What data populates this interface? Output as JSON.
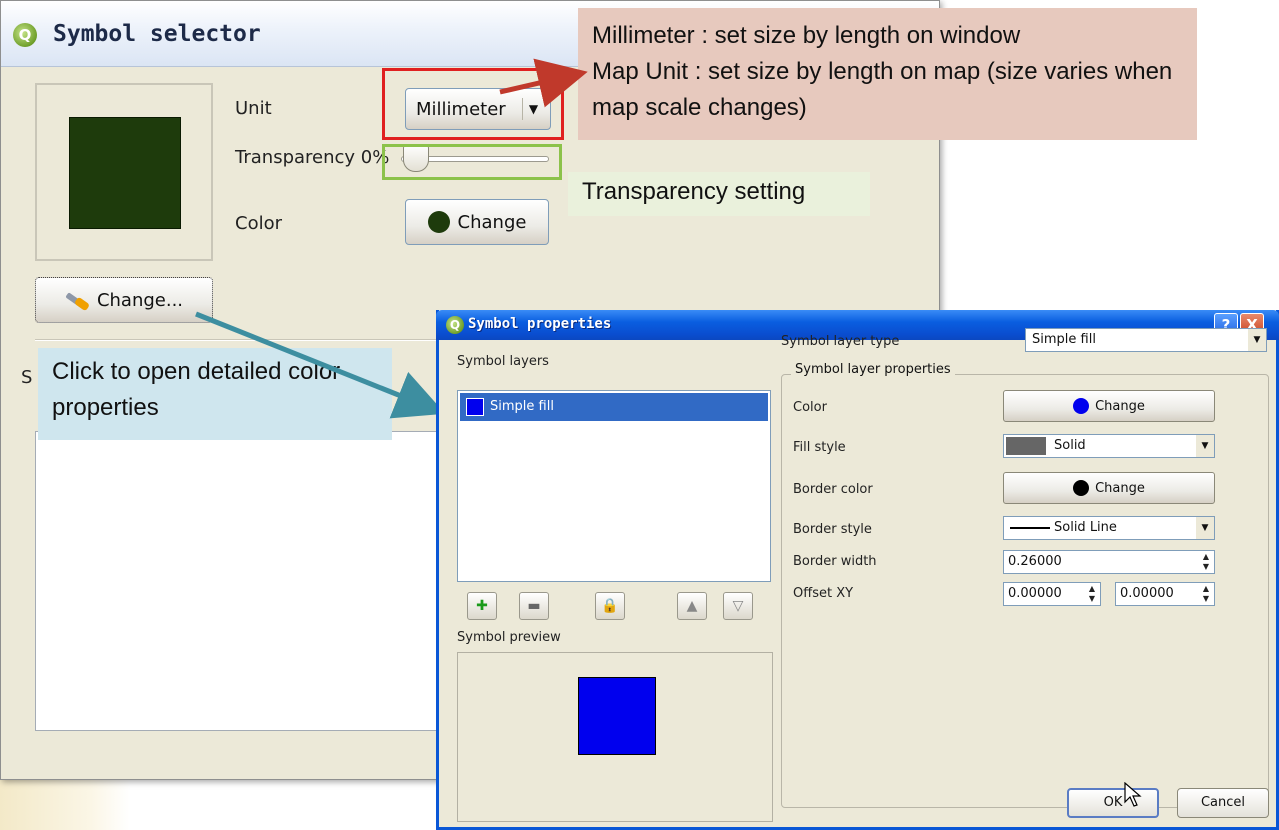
{
  "selector": {
    "title": "Symbol selector",
    "unit_label": "Unit",
    "unit_value": "Millimeter",
    "transparency_label": "Transparency 0%",
    "transparency_value": 0,
    "color_label": "Color",
    "change_label": "Change",
    "change_details_label": "Change...",
    "section_letter": "S",
    "preview_color": "#1e3b0c"
  },
  "notes": {
    "unit_line1": "Millimeter : set size by length on window",
    "unit_line2": "Map Unit : set size by length on map (size varies when map scale changes)",
    "transparency": "Transparency setting",
    "detail": "Click to open detailed color properties"
  },
  "properties": {
    "title": "Symbol properties",
    "help_label": "?",
    "close_label": "X",
    "symbol_layers_label": "Symbol layers",
    "layer_name": "Simple fill",
    "symbol_preview_label": "Symbol preview",
    "layer_type_label": "Symbol layer type",
    "layer_type_value": "Simple fill",
    "group_label": "Symbol layer properties",
    "color_label": "Color",
    "color_btn": "Change",
    "fill_style_label": "Fill style",
    "fill_style_value": "Solid",
    "border_color_label": "Border color",
    "border_color_btn": "Change",
    "border_style_label": "Border style",
    "border_style_value": "Solid Line",
    "border_width_label": "Border width",
    "border_width_value": "0.26000",
    "offset_label": "Offset XY",
    "offset_x": "0.00000",
    "offset_y": "0.00000",
    "ok_label": "OK",
    "cancel_label": "Cancel",
    "fill_color": "#0000ee",
    "border_color": "#000000"
  }
}
